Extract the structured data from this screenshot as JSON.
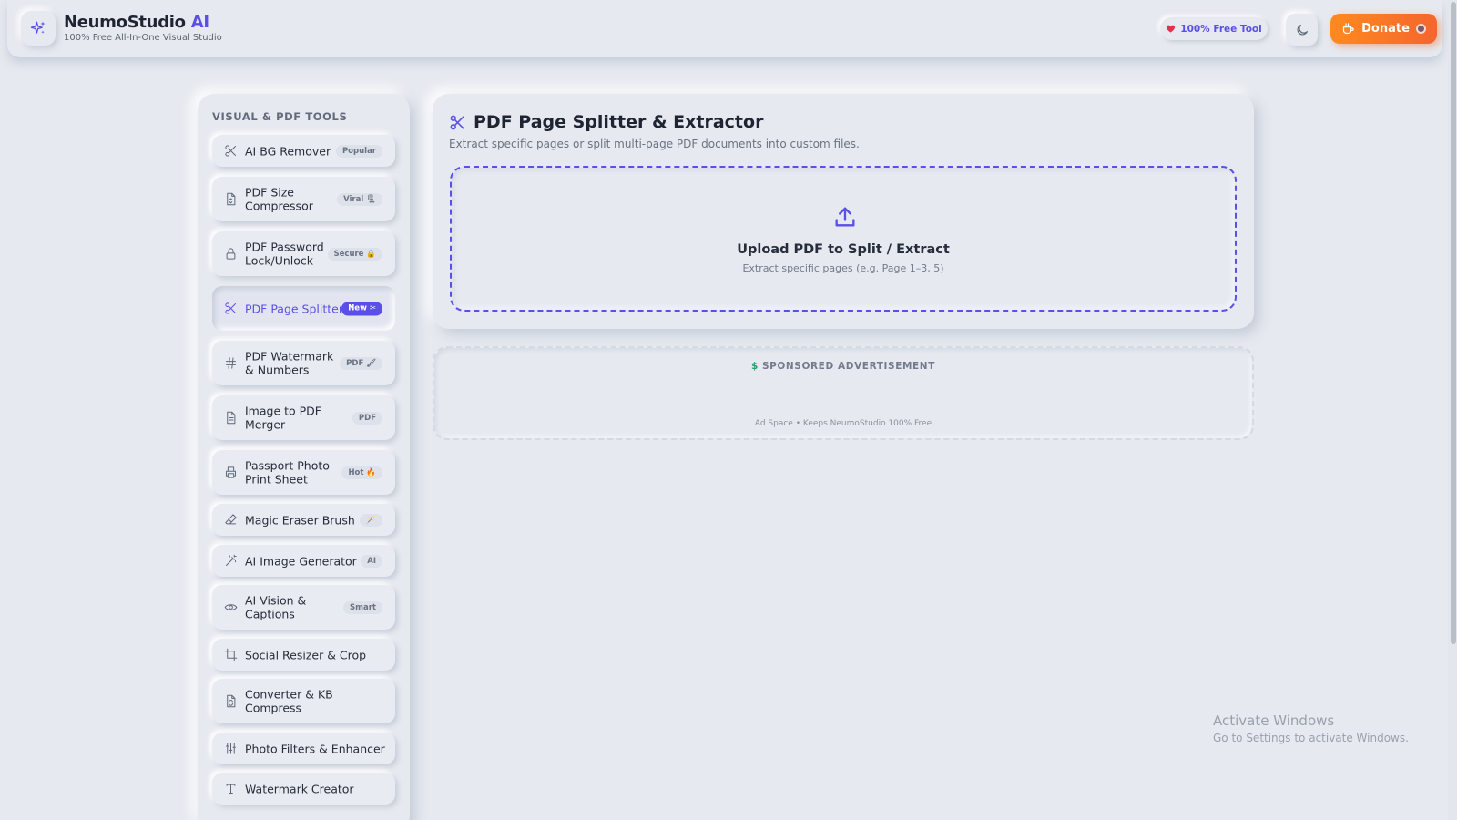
{
  "header": {
    "brand_name": "NeumoStudio",
    "brand_accent": "AI",
    "brand_subtitle": "100% Free All-In-One Visual Studio",
    "free_pill_label": "100% Free Tool",
    "donate_label": "Donate",
    "theme_toggle_icon": "moon-icon",
    "accent_color": "#5a4fe6",
    "donate_color": "#f4662e"
  },
  "sidebar": {
    "title": "VISUAL & PDF TOOLS",
    "items": [
      {
        "label": "AI BG Remover",
        "badge": "Popular",
        "icon": "scissors-icon",
        "active": false
      },
      {
        "label": "PDF Size Compressor",
        "badge": "Viral 🗜",
        "icon": "file-compress-icon",
        "active": false
      },
      {
        "label": "PDF Password Lock/Unlock",
        "badge": "Secure 🔒",
        "icon": "lock-icon",
        "active": false
      },
      {
        "label": "PDF Page Splitter",
        "badge": "New ✂",
        "icon": "scissors-icon",
        "active": true
      },
      {
        "label": "PDF Watermark & Numbers",
        "badge": "PDF 🖌",
        "icon": "hash-icon",
        "active": false
      },
      {
        "label": "Image to PDF Merger",
        "badge": "PDF",
        "icon": "document-icon",
        "active": false
      },
      {
        "label": "Passport Photo Print Sheet",
        "badge": "Hot 🔥",
        "icon": "printer-icon",
        "active": false
      },
      {
        "label": "Magic Eraser Brush",
        "badge": "🪄",
        "icon": "eraser-icon",
        "active": false
      },
      {
        "label": "AI Image Generator",
        "badge": "AI",
        "icon": "magic-wand-icon",
        "active": false
      },
      {
        "label": "AI Vision & Captions",
        "badge": "Smart",
        "icon": "eye-icon",
        "active": false
      },
      {
        "label": "Social Resizer & Crop",
        "badge": "",
        "icon": "crop-icon",
        "active": false
      },
      {
        "label": "Converter & KB Compress",
        "badge": "",
        "icon": "convert-icon",
        "active": false
      },
      {
        "label": "Photo Filters & Enhancer",
        "badge": "",
        "icon": "sliders-icon",
        "active": false
      },
      {
        "label": "Watermark Creator",
        "badge": "",
        "icon": "text-icon",
        "active": false
      }
    ]
  },
  "main": {
    "title": "PDF Page Splitter & Extractor",
    "subtitle": "Extract specific pages or split multi-page PDF documents into custom files.",
    "upload_title": "Upload PDF to Split / Extract",
    "upload_hint": "Extract specific pages (e.g. Page 1–3, 5)"
  },
  "ad": {
    "label": "SPONSORED ADVERTISEMENT",
    "footer": "Ad Space • Keeps NeumoStudio 100% Free"
  },
  "os_watermark": {
    "line1": "Activate Windows",
    "line2": "Go to Settings to activate Windows."
  }
}
